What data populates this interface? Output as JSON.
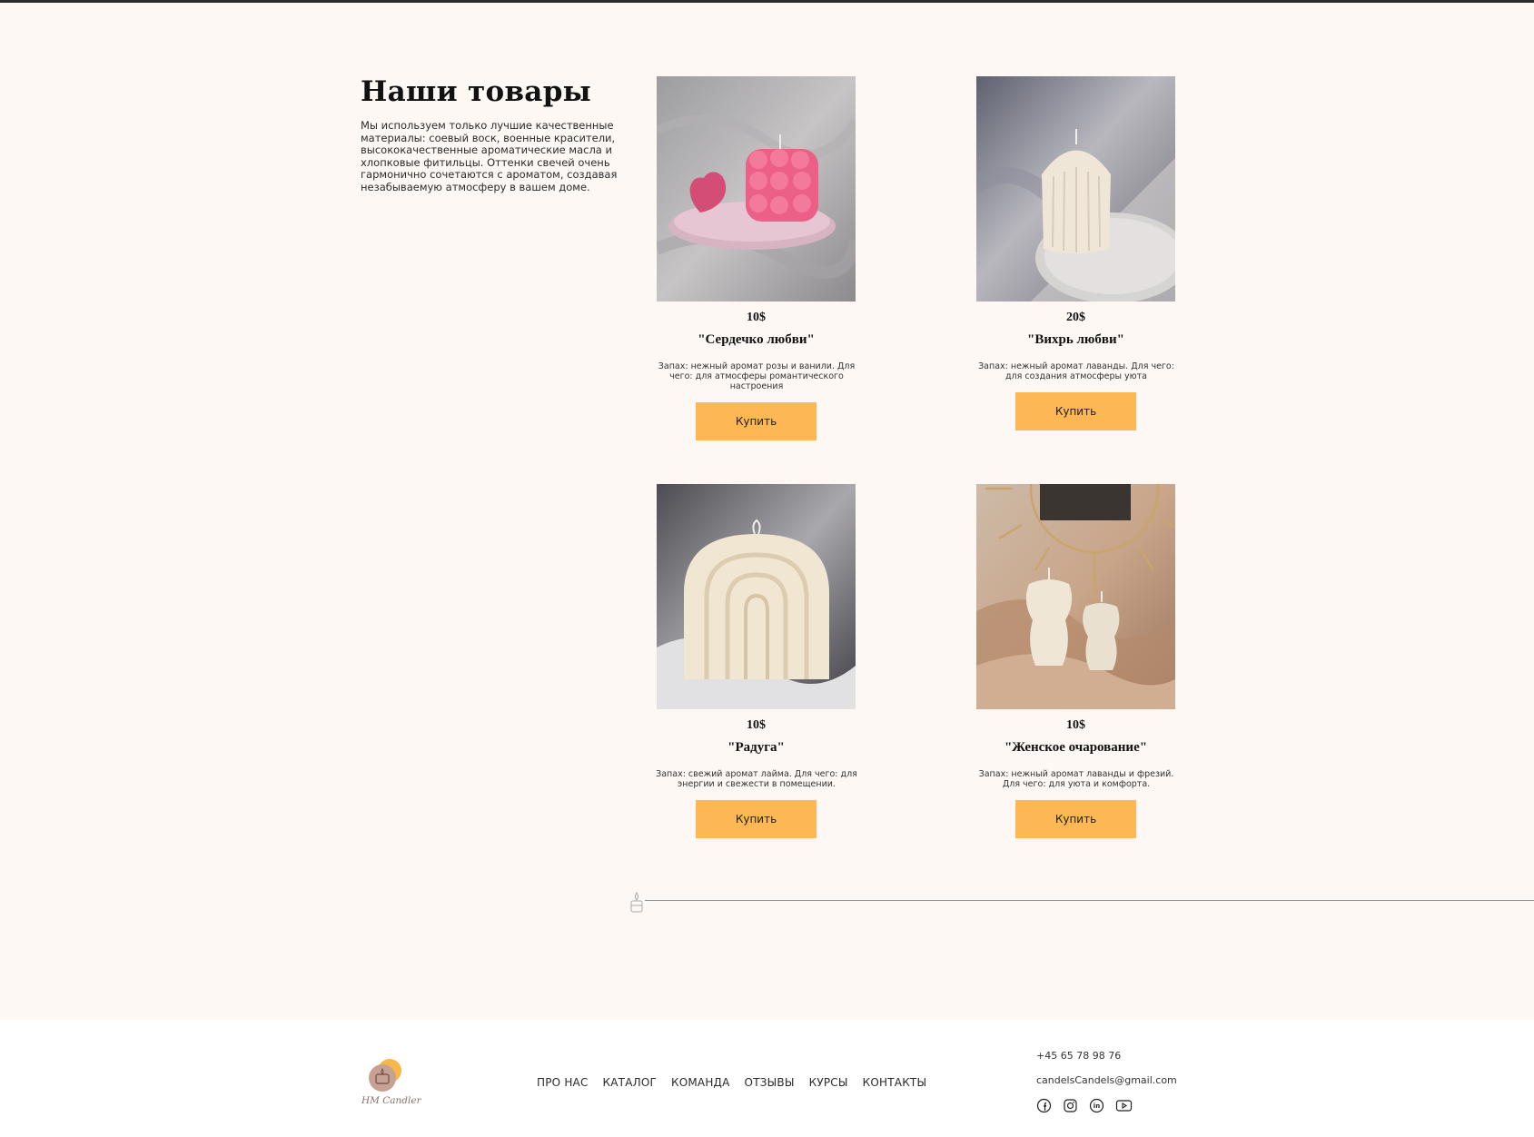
{
  "section": {
    "title": "Наши товары",
    "description": "Мы используем только лучшие качественные материалы: соевый воск, военные красители, высококачественные ароматические масла и хлопковые фитильцы. Оттенки свечей очень гармонично сочетаются с ароматом, создавая незабываемую атмосферу в вашем доме."
  },
  "products": [
    {
      "price": "10$",
      "name": "\"Сердечко любви\"",
      "desc": "Запах: нежный аромат розы и ванили. Для чего: для атмосферы романтического настроения",
      "button": "Купить"
    },
    {
      "price": "20$",
      "name": "\"Вихрь любви\"",
      "desc": "Запах: нежный аромат лаванды. Для чего: для создания атмосферы уюта",
      "button": "Купить"
    },
    {
      "price": "10$",
      "name": "\"Радуга\"",
      "desc": "Запах: свежий аромат лайма. Для чего: для энергии и свежести в помещении.",
      "button": "Купить"
    },
    {
      "price": "10$",
      "name": "\"Женское очарование\"",
      "desc": "Запах: нежный аромат лаванды и фрезий. Для чего: для уюта и комфорта.",
      "button": "Купить"
    }
  ],
  "footer": {
    "logo_text": "HM Candler",
    "nav": [
      "ПРО НАС",
      "КАТАЛОГ",
      "КОМАНДА",
      "ОТЗЫВЫ",
      "КУРСЫ",
      "КОНТАКТЫ"
    ],
    "phone": "+45 65 78 98 76",
    "email": "candelsCandels@gmail.com",
    "socials": [
      "facebook-icon",
      "instagram-icon",
      "linkedin-icon",
      "youtube-icon"
    ]
  },
  "colors": {
    "background": "#fdf8f3",
    "button": "#fdb855",
    "text": "#1d1d1d"
  }
}
